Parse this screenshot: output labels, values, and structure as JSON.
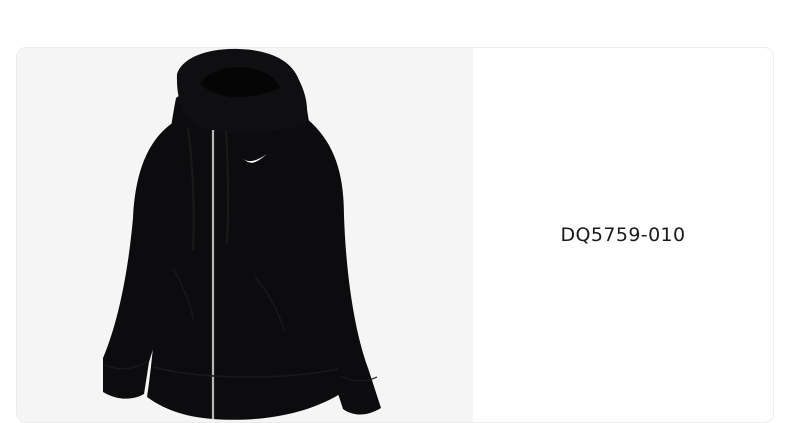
{
  "product": {
    "image_name": "black-full-zip-hoodie",
    "sku": "DQ5759-010"
  },
  "colors": {
    "image_background": "#f5f5f5",
    "hoodie": "#0c0c0e",
    "zipper": "#b7b7b7",
    "logo": "#ffffff"
  }
}
